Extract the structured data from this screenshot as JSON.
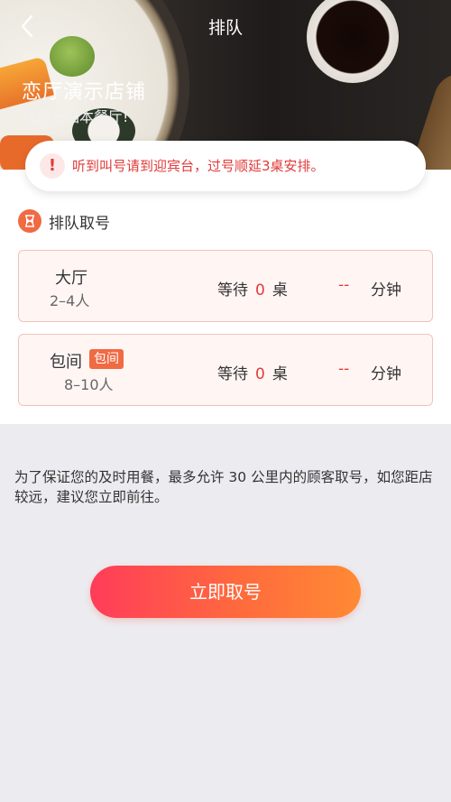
{
  "header": {
    "title": "排队",
    "back_icon": "chevron-left-icon",
    "shop_name": "恋厅演示店铺",
    "welcome": "欢迎光临本餐厅!"
  },
  "notice": {
    "icon": "exclamation-icon",
    "text": "听到叫号请到迎宾台，过号顺延3桌安排。"
  },
  "section": {
    "icon": "hourglass-icon",
    "title": "排队取号"
  },
  "queues": [
    {
      "name": "大厅",
      "size": "2–4人",
      "tag": "",
      "wait_prefix": "等待",
      "wait_count": "0",
      "wait_unit": "桌",
      "eta": "--",
      "eta_unit": "分钟"
    },
    {
      "name": "包间",
      "size": "8–10人",
      "tag": "包间",
      "wait_prefix": "等待",
      "wait_count": "0",
      "wait_unit": "桌",
      "eta": "--",
      "eta_unit": "分钟"
    }
  ],
  "info_text": "为了保证您的及时用餐，最多允许 30 公里内的顾客取号，如您距店较远，建议您立即前往。",
  "cta_label": "立即取号",
  "colors": {
    "accent": "#e23a3a",
    "button_start": "#ff3c5a",
    "button_end": "#ff8a34",
    "card_bg": "#fff6f4"
  }
}
